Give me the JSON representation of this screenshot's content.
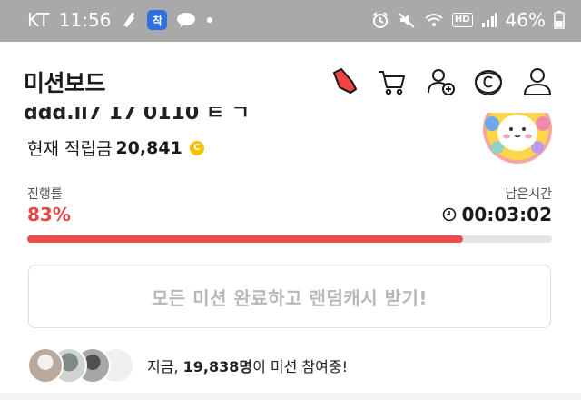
{
  "status_bar": {
    "carrier": "KT",
    "time": "11:56",
    "app_badge": "착",
    "battery": "46%",
    "hd_label": "HD"
  },
  "header": {
    "title": "미션보드",
    "icons": [
      "shoe-icon",
      "cart-icon",
      "add-friend-icon",
      "cash-coin-icon",
      "profile-icon"
    ]
  },
  "summary": {
    "clipped_heading": "ddd.ll7 17 0110 ㅌ ㄱ",
    "points_label": "현재 적립금",
    "points_value": "20,841",
    "coin_symbol": "C"
  },
  "progress": {
    "label": "진행률",
    "value": "83%",
    "fraction": 0.83,
    "remaining_label": "남은시간",
    "remaining_value": "00:03:02"
  },
  "cta": {
    "label": "모든 미션 완료하고 랜덤캐시 받기!"
  },
  "participants": {
    "prefix": "지금, ",
    "count": "19,838명",
    "suffix": "이 미션 참여중!"
  },
  "colors": {
    "accent": "#ee4d4d",
    "percent_text": "#e24a4a",
    "coin": "#f2c300",
    "status_bar": "#a9a9a9"
  }
}
